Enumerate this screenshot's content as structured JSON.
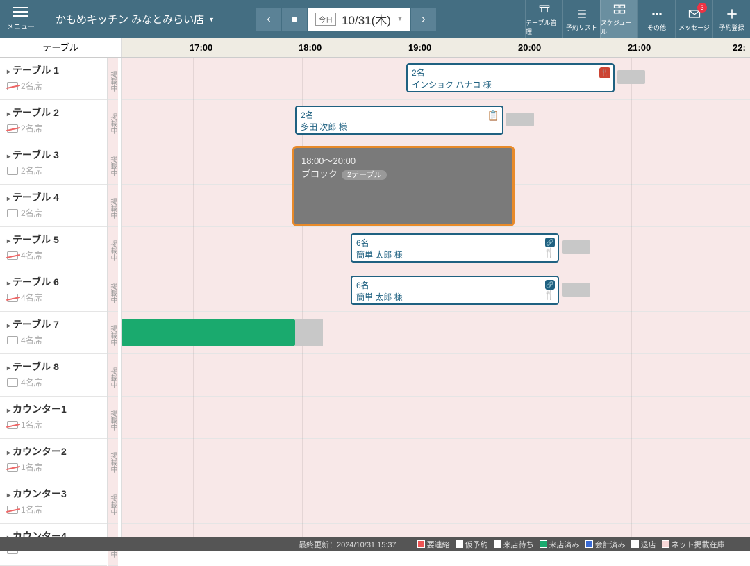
{
  "header": {
    "menu_label": "メニュー",
    "store": "かもめキッチン みなとみらい店",
    "today": "今日",
    "date": "10/31(木)",
    "items": [
      {
        "label": "テーブル管理"
      },
      {
        "label": "予約リスト"
      },
      {
        "label": "スケジュール"
      },
      {
        "label": "その他"
      },
      {
        "label": "メッセージ",
        "badge": "3"
      },
      {
        "label": "予約登録"
      }
    ]
  },
  "time_header": {
    "label": "テーブル",
    "times": [
      "17:00",
      "18:00",
      "19:00",
      "20:00",
      "21:00",
      "22:"
    ]
  },
  "tables": [
    {
      "name": "テーブル 1",
      "seats": "2名席",
      "no": true
    },
    {
      "name": "テーブル 2",
      "seats": "2名席",
      "no": true
    },
    {
      "name": "テーブル 3",
      "seats": "2名席",
      "no": false
    },
    {
      "name": "テーブル 4",
      "seats": "2名席",
      "no": false
    },
    {
      "name": "テーブル 5",
      "seats": "4名席",
      "no": true
    },
    {
      "name": "テーブル 6",
      "seats": "4名席",
      "no": true
    },
    {
      "name": "テーブル 7",
      "seats": "4名席",
      "no": false
    },
    {
      "name": "テーブル 8",
      "seats": "4名席",
      "no": false
    },
    {
      "name": "カウンター1",
      "seats": "1名席",
      "no": true
    },
    {
      "name": "カウンター2",
      "seats": "1名席",
      "no": true
    },
    {
      "name": "カウンター3",
      "seats": "1名席",
      "no": true
    },
    {
      "name": "カウンター4",
      "seats": "",
      "no": false
    }
  ],
  "pub_label": "掲載中",
  "resv1": {
    "guests": "2名",
    "name": "インショク ハナコ 様"
  },
  "resv2": {
    "guests": "2名",
    "name": "多田 次郎 様"
  },
  "block": {
    "time": "18:00～20:00",
    "label": "ブロック",
    "pill": "2テーブル"
  },
  "resv3": {
    "guests": "6名",
    "name": "簡単 太郎 様"
  },
  "resv4": {
    "guests": "6名",
    "name": "簡単 太郎 様"
  },
  "footer": {
    "updated": "最終更新：2024/10/31 15:37",
    "legend": [
      {
        "c": "#e55",
        "t": "要連絡"
      },
      {
        "c": "#fff",
        "t": "仮予約"
      },
      {
        "c": "#fff",
        "t": "来店待ち"
      },
      {
        "c": "#1aaa6e",
        "t": "来店済み"
      },
      {
        "c": "#3a6bd4",
        "t": "会計済み"
      },
      {
        "c": "#fff",
        "t": "退店"
      },
      {
        "c": "#f8d8d8",
        "t": "ネット掲載在庫"
      }
    ]
  }
}
